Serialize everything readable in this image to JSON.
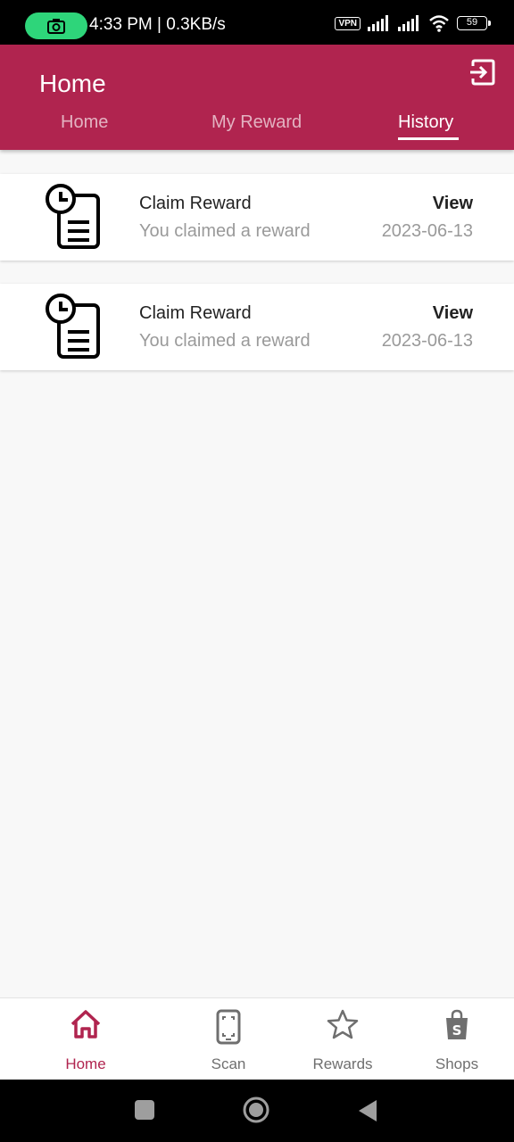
{
  "status_bar": {
    "time_speed": "4:33 PM | 0.3KB/s",
    "vpn": "VPN",
    "battery": "59"
  },
  "header": {
    "title": "Home",
    "tabs": [
      {
        "label": "Home",
        "active": false
      },
      {
        "label": "My Reward",
        "active": false
      },
      {
        "label": "History",
        "active": true
      }
    ]
  },
  "history": {
    "items": [
      {
        "title": "Claim Reward",
        "subtitle": "You claimed a reward",
        "action": "View",
        "date": "2023-06-13"
      },
      {
        "title": "Claim Reward",
        "subtitle": "You claimed a reward",
        "action": "View",
        "date": "2023-06-13"
      }
    ]
  },
  "bottom_nav": {
    "items": [
      {
        "label": "Home",
        "icon": "home-icon",
        "active": true
      },
      {
        "label": "Scan",
        "icon": "phone-scan-icon",
        "active": false
      },
      {
        "label": "Rewards",
        "icon": "star-icon",
        "active": false
      },
      {
        "label": "Shops",
        "icon": "shopping-bag-icon",
        "active": false
      }
    ]
  },
  "colors": {
    "primary": "#b0244f",
    "status_pill": "#2ed57a",
    "background": "#f8f8f8"
  }
}
